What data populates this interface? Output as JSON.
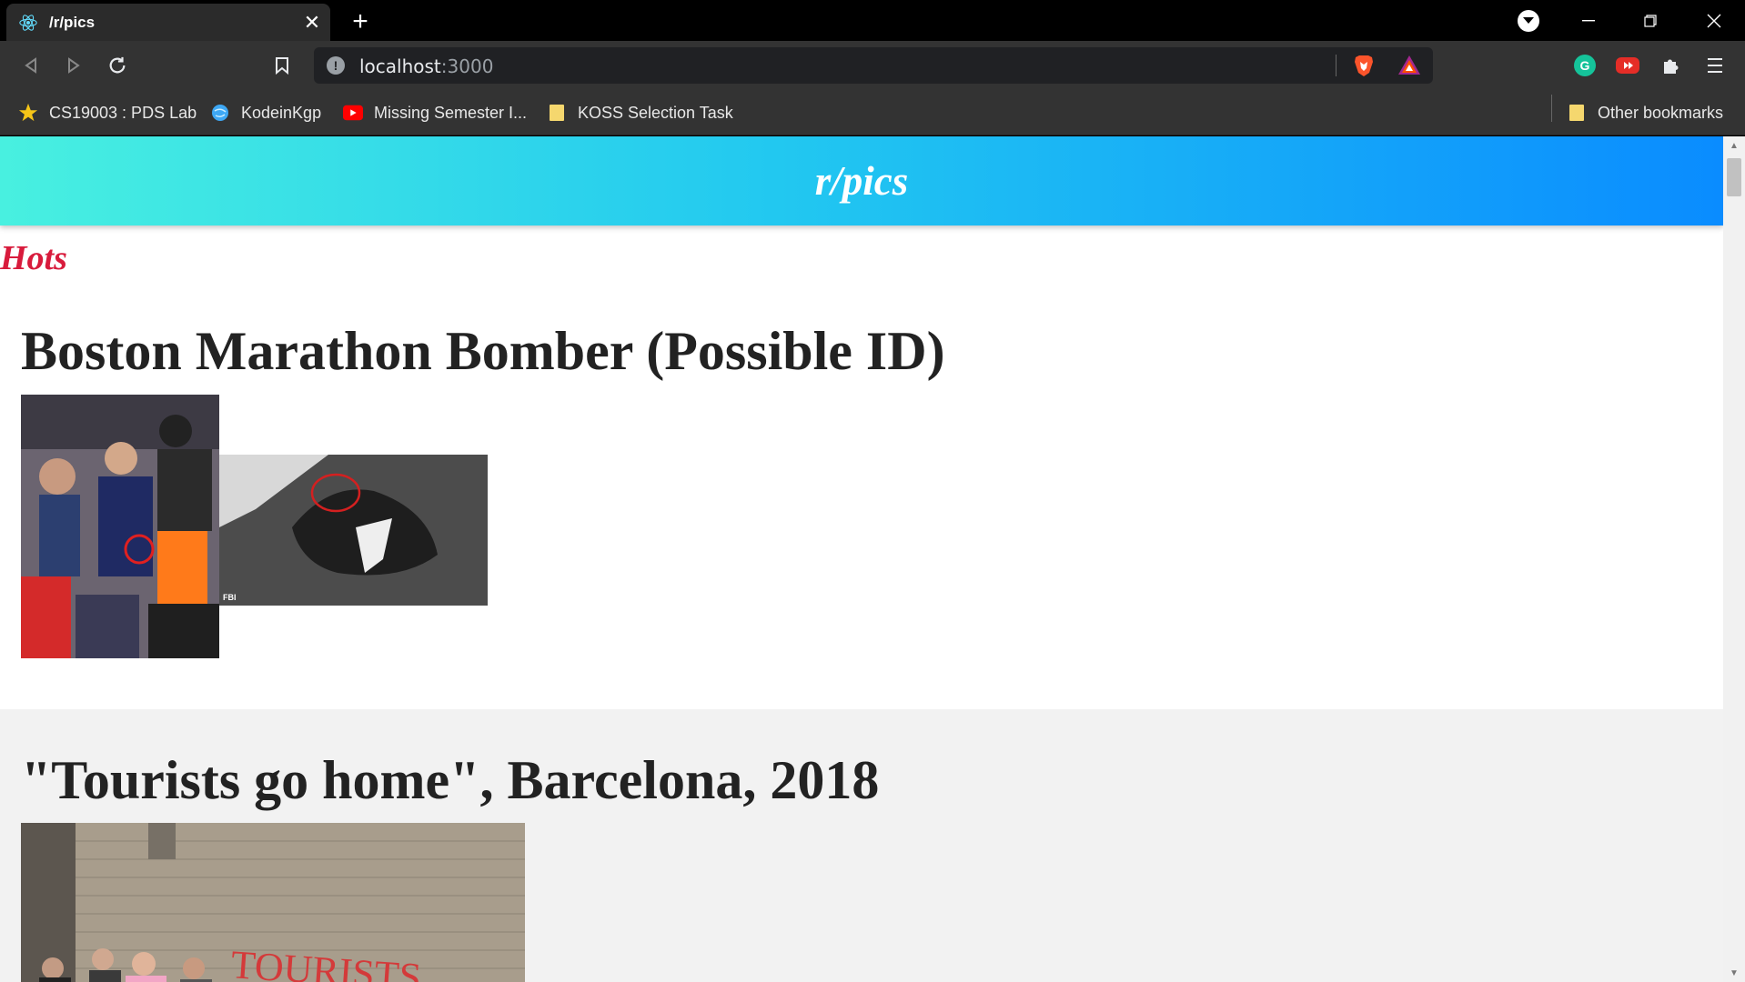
{
  "browser": {
    "tab_title": "/r/pics",
    "address": {
      "host": "localhost",
      "port": ":3000"
    },
    "bookmarks": [
      {
        "label": "CS19003 : PDS Lab",
        "icon": "star-icon"
      },
      {
        "label": "KodeinKgp",
        "icon": "globe-icon"
      },
      {
        "label": "Missing Semester I...",
        "icon": "youtube-icon"
      },
      {
        "label": "KOSS Selection Task",
        "icon": "folder-icon"
      }
    ],
    "other_bookmarks": "Other bookmarks"
  },
  "page": {
    "header_title": "r/pics",
    "section_title": "Hots",
    "posts": [
      {
        "title": "Boston Marathon Bomber (Possible ID)",
        "image_caption": "FBI"
      },
      {
        "title": "\"Tourists go home\", Barcelona, 2018",
        "image_caption": "TOURISTS"
      }
    ]
  },
  "colors": {
    "header_gradient_start": "#48f0e0",
    "header_gradient_end": "#0a8cff",
    "section_title": "#d81b3c"
  }
}
